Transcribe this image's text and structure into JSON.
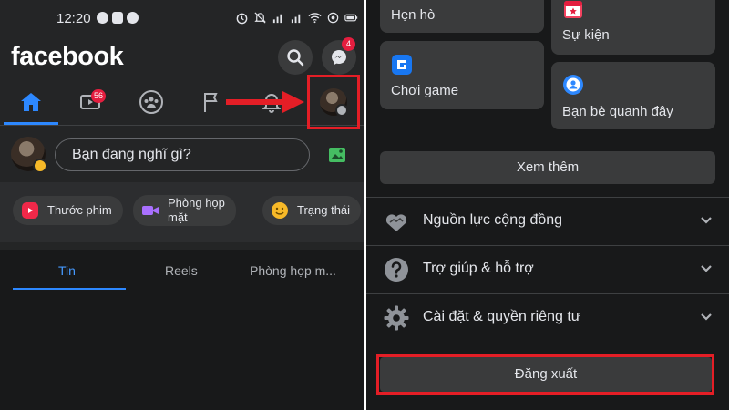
{
  "status_bar": {
    "time": "12:20"
  },
  "header": {
    "logo": "facebook"
  },
  "badges": {
    "messenger": "4",
    "watch": "56"
  },
  "composer": {
    "placeholder": "Bạn đang nghĩ gì?"
  },
  "chips": [
    {
      "label": "Thước phim",
      "icon": "reels-icon"
    },
    {
      "label": "Phòng họp\nmặt",
      "icon": "video-room-icon"
    },
    {
      "label": "Trạng thái",
      "icon": "smile-emoji-icon"
    }
  ],
  "feed_tabs": [
    {
      "label": "Tin",
      "active": true
    },
    {
      "label": "Reels",
      "active": false
    },
    {
      "label": "Phòng họp m...",
      "active": false
    }
  ],
  "shortcuts": [
    {
      "label": "Hẹn hò",
      "icon": "dating-icon"
    },
    {
      "label": "Sự kiện",
      "icon": "calendar-star-icon"
    },
    {
      "label": "Chơi game",
      "icon": "gaming-icon"
    },
    {
      "label": "Bạn bè quanh đây",
      "icon": "nearby-friends-icon"
    }
  ],
  "see_more_label": "Xem thêm",
  "menu": [
    {
      "label": "Nguồn lực cộng đồng",
      "icon": "handshake-heart-icon"
    },
    {
      "label": "Trợ giúp & hỗ trợ",
      "icon": "help-circle-icon"
    },
    {
      "label": "Cài đặt & quyền riêng tư",
      "icon": "gear-icon"
    }
  ],
  "logout_label": "Đăng xuất",
  "colors": {
    "background": "#242526",
    "panel": "#18191a",
    "card": "#3a3b3c",
    "accent": "#2d88ff",
    "highlight": "#e41e26",
    "badge": "#e41e3f"
  }
}
